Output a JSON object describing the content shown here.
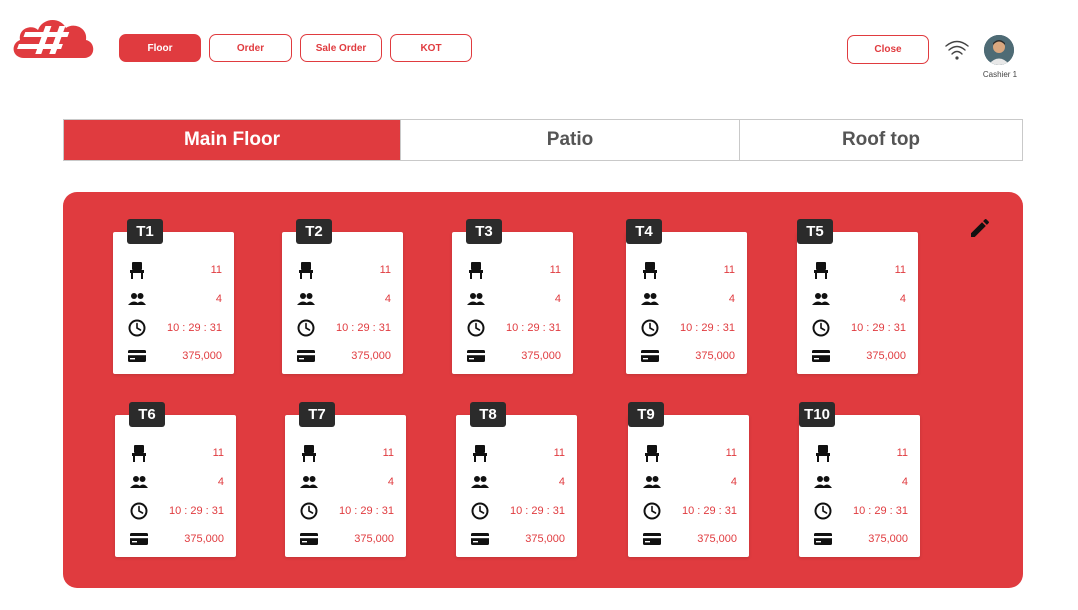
{
  "nav": {
    "buttons": [
      {
        "label": "Floor",
        "active": true
      },
      {
        "label": "Order",
        "active": false
      },
      {
        "label": "Sale Order",
        "active": false
      },
      {
        "label": "KOT",
        "active": false
      }
    ],
    "close_label": "Close",
    "user_label": "Cashier 1"
  },
  "tabs": [
    {
      "label": "Main Floor",
      "active": true
    },
    {
      "label": "Patio",
      "active": false
    },
    {
      "label": "Roof top",
      "active": false
    }
  ],
  "tables": [
    {
      "name": "T1",
      "seats": "11",
      "guests": "4",
      "time": "10 : 29 : 31",
      "amount": "375,000"
    },
    {
      "name": "T2",
      "seats": "11",
      "guests": "4",
      "time": "10 : 29 : 31",
      "amount": "375,000"
    },
    {
      "name": "T3",
      "seats": "11",
      "guests": "4",
      "time": "10 : 29 : 31",
      "amount": "375,000"
    },
    {
      "name": "T4",
      "seats": "11",
      "guests": "4",
      "time": "10 : 29 : 31",
      "amount": "375,000"
    },
    {
      "name": "T5",
      "seats": "11",
      "guests": "4",
      "time": "10 : 29 : 31",
      "amount": "375,000"
    },
    {
      "name": "T6",
      "seats": "11",
      "guests": "4",
      "time": "10 : 29 : 31",
      "amount": "375,000"
    },
    {
      "name": "T7",
      "seats": "11",
      "guests": "4",
      "time": "10 : 29 : 31",
      "amount": "375,000"
    },
    {
      "name": "T8",
      "seats": "11",
      "guests": "4",
      "time": "10 : 29 : 31",
      "amount": "375,000"
    },
    {
      "name": "T9",
      "seats": "11",
      "guests": "4",
      "time": "10 : 29 : 31",
      "amount": "375,000"
    },
    {
      "name": "T10",
      "seats": "11",
      "guests": "4",
      "time": "10 : 29 : 31",
      "amount": "375,000"
    }
  ],
  "icons": {
    "row_icons": [
      "chair-icon",
      "people-icon",
      "clock-icon",
      "card-icon"
    ],
    "edit": "pencil-icon",
    "wifi": "wifi-icon"
  },
  "colors": {
    "accent": "#e03b3f",
    "tag": "#2b2b2b"
  }
}
